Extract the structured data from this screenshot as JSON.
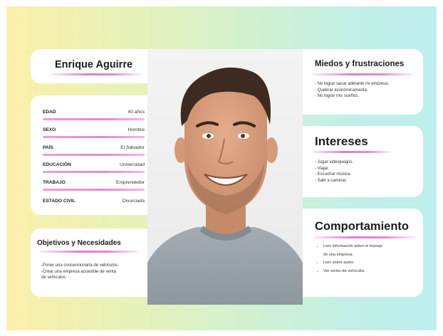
{
  "persona": {
    "name": "Enrique Aguirre",
    "details": [
      {
        "label": "EDAD",
        "value": "40 años"
      },
      {
        "label": "SEXO",
        "value": "Hombre"
      },
      {
        "label": "PAÍS",
        "value": "El Salvador"
      },
      {
        "label": "EDUCACIÓN",
        "value": "Universidad"
      },
      {
        "label": "TRABAJO",
        "value": "Emprendedor"
      },
      {
        "label": "ESTADO CIVIL",
        "value": "Divorciada"
      }
    ]
  },
  "goals": {
    "title": "Objetivos y Necesidades",
    "lines": [
      "-Poner una concencionaria de vehículos.",
      "-Crear una empresa accesible de venta",
      "de vehículos."
    ]
  },
  "fears": {
    "title": "Miedos y frustraciones",
    "lines": [
      "- No lograr sacar adelante mi empresa.",
      "- Quebrar económicamente.",
      "- No lograr mis sueños."
    ]
  },
  "interests": {
    "title": "Intereses",
    "lines": [
      "- Jugar videojuegos.",
      "- Viajar.",
      "- Escuchar música.",
      "- Salir a caminar."
    ]
  },
  "behavior": {
    "title": "Comportamiento",
    "items": [
      "Leer información sobre el manejo",
      "de una empresa.",
      "Leer sobre autos.",
      "Ver series de vehículos ."
    ]
  },
  "colors": {
    "accent_underline": "#e07bd2",
    "background_left": "#fbefaa",
    "background_right": "#bcefee",
    "shirt": "#9aa3ab",
    "skin": "#d9a07f",
    "hair": "#3d2a20"
  },
  "icons": {
    "photo": "portrait-photo"
  }
}
